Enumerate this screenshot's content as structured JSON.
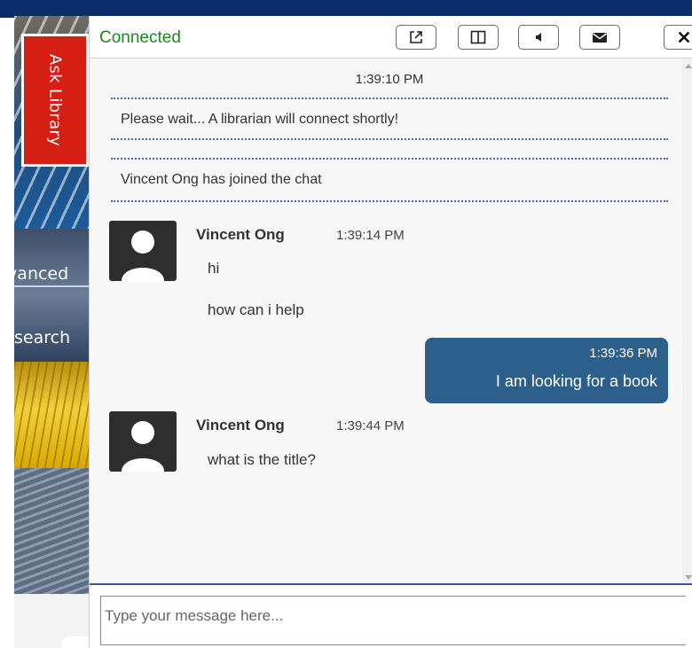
{
  "background": {
    "advanced_text": "dvanced",
    "search_text": "search"
  },
  "ask_tab": {
    "label": "Ask Library"
  },
  "header": {
    "status": "Connected",
    "buttons": [
      "popout-icon",
      "split-view-icon",
      "sound-icon",
      "email-icon",
      "close-icon"
    ]
  },
  "transcript": {
    "system_time": "1:39:10 PM",
    "system_messages": [
      "Please wait... A librarian will connect shortly!",
      "Vincent Ong has joined the chat"
    ],
    "messages": [
      {
        "sender": "Vincent Ong",
        "time": "1:39:14 PM",
        "lines": [
          "hi",
          "how can i help"
        ]
      },
      {
        "sender": "patron",
        "time": "1:39:36 PM",
        "lines": [
          "I am looking for a book"
        ]
      },
      {
        "sender": "Vincent Ong",
        "time": "1:39:44 PM",
        "lines": [
          "what is the title?"
        ]
      }
    ]
  },
  "composer": {
    "placeholder": "Type your message here..."
  },
  "colors": {
    "status_green": "#1a8a1a",
    "ask_tab_red": "#d51e14",
    "patron_bubble": "#2d5f8c",
    "divider_blue": "#3a72b8"
  }
}
